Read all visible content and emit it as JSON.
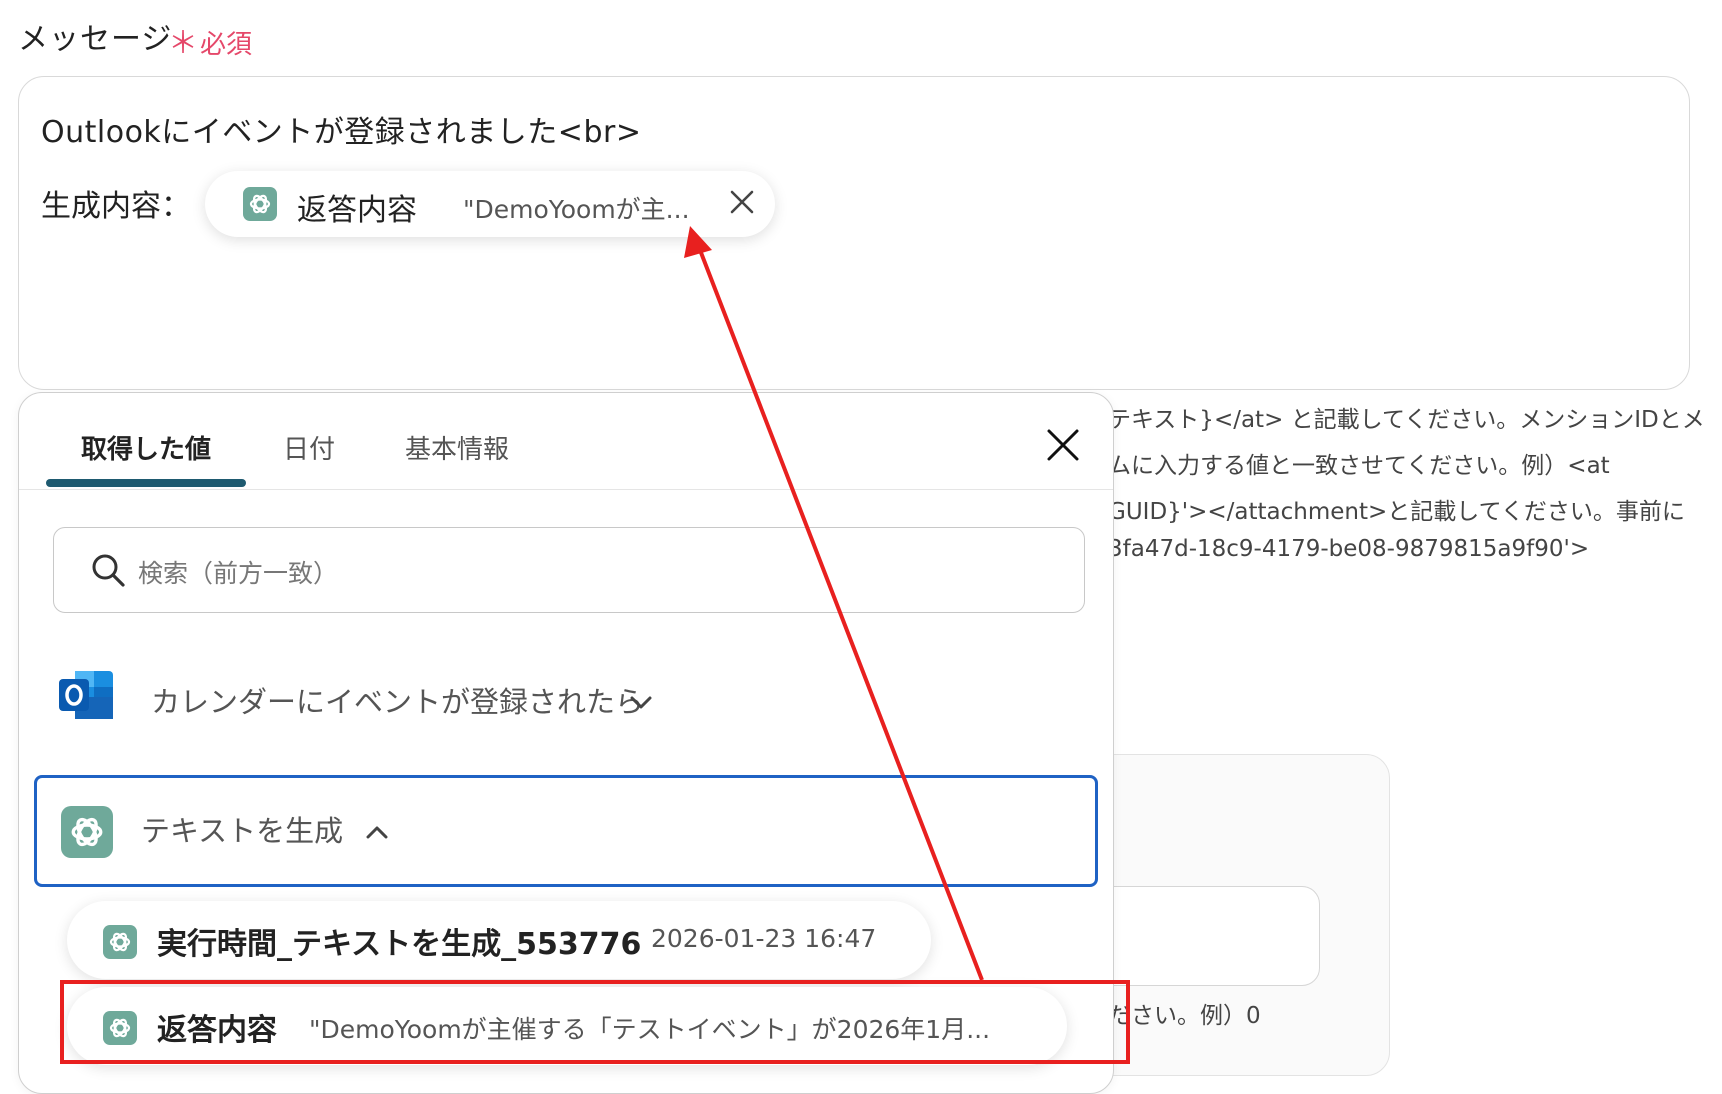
{
  "field": {
    "label": "メッセージ",
    "required_star": "＊",
    "required": "必須"
  },
  "message": {
    "line1": "Outlookにイベントが登録されました<br>",
    "label2": "生成内容：",
    "chip": {
      "icon": "chatgpt-icon",
      "name": "返答内容",
      "value": "\"DemoYoomが主..."
    }
  },
  "help_text": [
    "テキスト}</at> と記載してください。メンションIDとメ",
    "ムに入力する値と一致させてください。例）<at",
    "GUID}'></attachment>と記載してください。事前に",
    "3fa47d-18c9-4179-be08-9879815a9f90'>"
  ],
  "bg_hint": "ださい。例）0",
  "panel": {
    "tabs": [
      "取得した値",
      "日付",
      "基本情報"
    ],
    "active_tab": "取得した値",
    "search_placeholder": "検索（前方一致）",
    "groups": [
      {
        "icon": "outlook-icon",
        "title": "カレンダーにイベントが登録されたら",
        "expanded": false
      },
      {
        "icon": "chatgpt-icon",
        "title": "テキストを生成",
        "expanded": true
      }
    ],
    "items": [
      {
        "icon": "chatgpt-icon",
        "name": "実行時間_テキストを生成_553776",
        "value": "2026-01-23 16:47"
      },
      {
        "icon": "chatgpt-icon",
        "name": "返答内容",
        "value": "\"DemoYoomが主催する「テストイベント」が2026年1月..."
      }
    ]
  },
  "colors": {
    "accent_tab": "#1e5a70",
    "selected_border": "#1f62c4",
    "annotation_red": "#e8201f",
    "required_red": "#e5486a",
    "chatgpt_green": "#6fa99a"
  }
}
